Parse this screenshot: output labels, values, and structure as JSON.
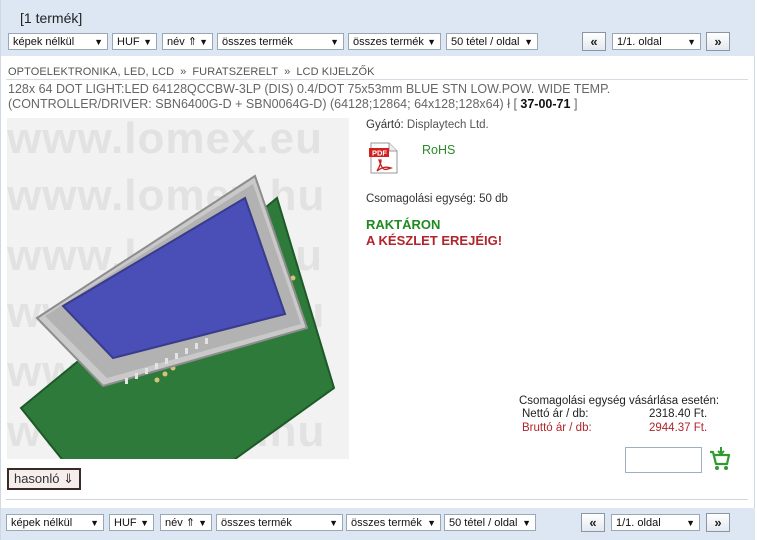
{
  "header": {
    "count": "[1 termék]"
  },
  "filters": {
    "images": "képek nélkül",
    "currency": "HUF",
    "sort": "név ⇑",
    "products1": "összes termék",
    "products2": "összes termék",
    "per_page": "50 tétel / oldal",
    "prev": "«",
    "page": "1/1. oldal",
    "next": "»"
  },
  "breadcrumb": [
    "OPTOELEKTRONIKA, LED, LCD",
    "FURATSZERELT",
    "LCD KIJELZŐK"
  ],
  "breadcrumb_sep": "»",
  "product": {
    "title_line1": "128x 64 DOT LIGHT:LED 64128QCCBW-3LP (DIS) 0.4/DOT 75x53mm BLUE STN LOW.POW. WIDE TEMP.",
    "title_line2": "(CONTROLLER/DRIVER: SBN6400G-D + SBN0064G-D) (64128;12864; 64x128;128x64) ł [",
    "code": "37-00-71",
    "code_close": "]",
    "watermark": "www.lomex.eu",
    "watermark_hu": "www.lomex.hu",
    "manufacturer_label": "Gyártó:",
    "manufacturer": "Displaytech Ltd.",
    "rohs": "RoHS",
    "pdf_icon_text": "PDF",
    "pack_unit": "Csomagolási egység: 50 db",
    "stock1": "RAKTÁRON",
    "stock2": "A KÉSZLET EREJÉIG!",
    "price_heading": "Csomagolási egység vásárlása esetén:",
    "net_label": "Nettó ár / db:",
    "net_price": "2318.40 Ft.",
    "gross_label": "Bruttó ár / db:",
    "gross_price": "2944.37 Ft.",
    "similar": "hasonló ⇓"
  },
  "colors": {
    "green": "#1f8a1f",
    "red": "#b0242b",
    "bar": "#dde7f3"
  }
}
